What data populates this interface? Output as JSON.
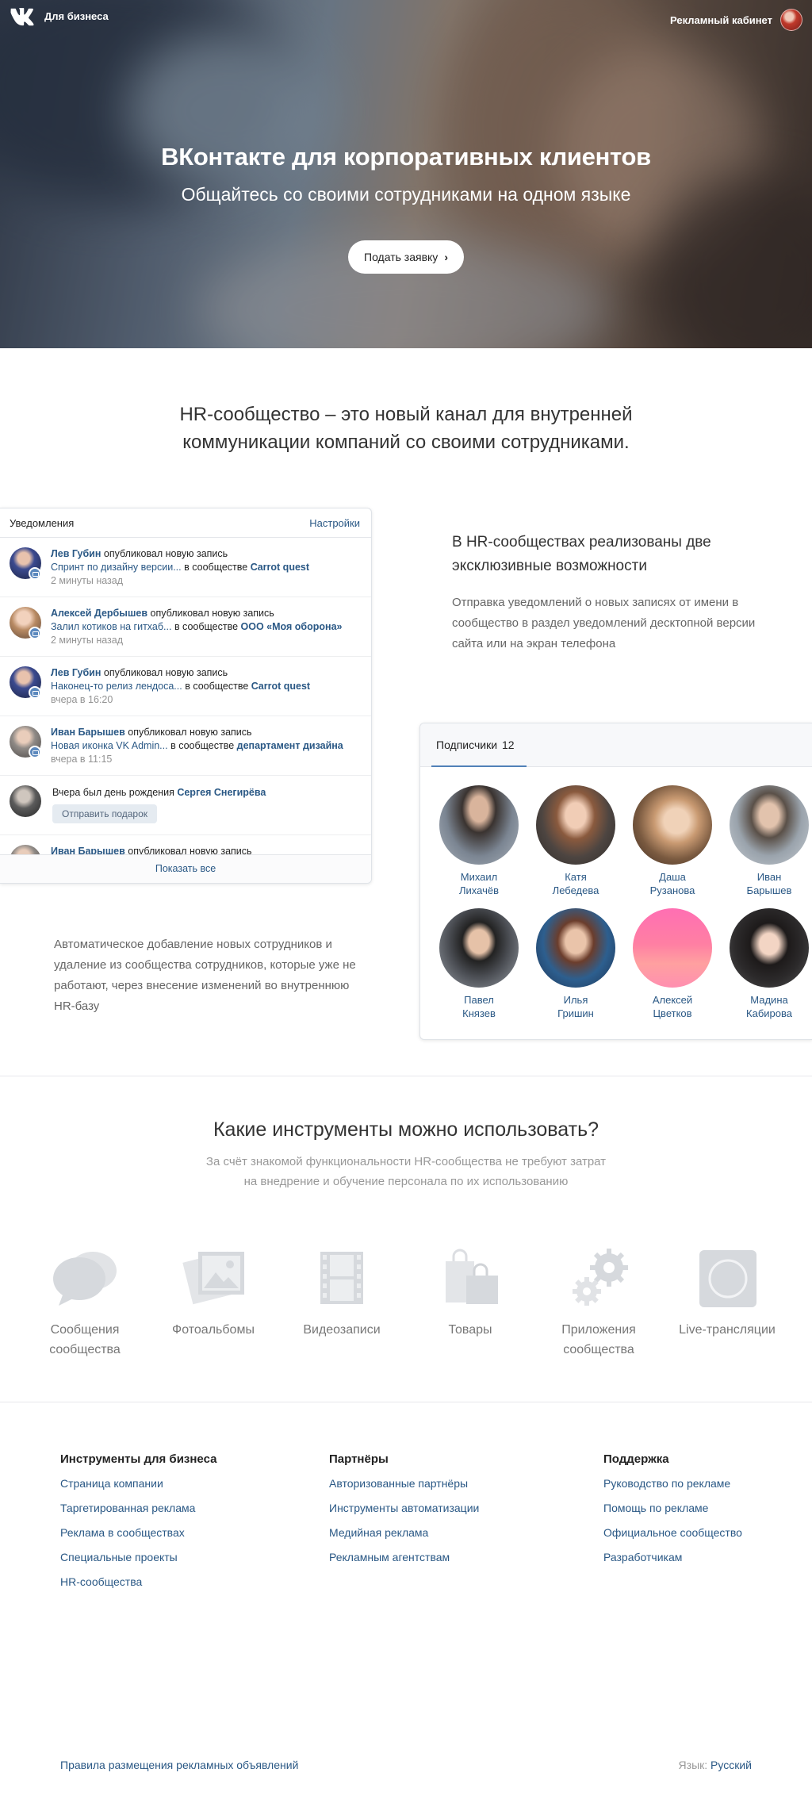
{
  "header": {
    "brand": "Для бизнеса",
    "cabinet": "Рекламный кабинет"
  },
  "hero": {
    "title": "ВКонтакте для корпоративных клиентов",
    "subtitle": "Общайтесь со своими сотрудниками на одном языке",
    "button": "Подать заявку"
  },
  "intro": "HR-сообщество – это новый канал для внутренней коммуникации компаний со своими сотрудниками.",
  "notifications": {
    "title": "Уведомления",
    "settings": "Настройки",
    "items": [
      {
        "author": "Лев Губин",
        "action": "опубликовал новую запись",
        "snippet": "Спринт по дизайну версии...",
        "in_group": "в сообществе",
        "group": "Carrot quest",
        "time": "2 минуты назад"
      },
      {
        "author": "Алексей Дербышев",
        "action": "опубликовал новую запись",
        "snippet": "Залил котиков на гитхаб...",
        "in_group": "в сообществе",
        "group": "ООО «Моя оборона»",
        "time": "2 минуты назад"
      },
      {
        "author": "Лев Губин",
        "action": "опубликовал новую запись",
        "snippet": "Наконец-то релиз лендоса...",
        "in_group": "в сообществе",
        "group": "Carrot quest",
        "time": "вчера в 16:20"
      },
      {
        "author": "Иван Барышев",
        "action": "опубликовал новую запись",
        "snippet": "Новая иконка VK Admin...",
        "in_group": "в сообществе",
        "group": "департамент дизайна",
        "time": "вчера в 11:15"
      }
    ],
    "birthday": {
      "text": "Вчера был день рождения",
      "person": "Сергея Снегирёва",
      "button": "Отправить подарок"
    },
    "last": {
      "author": "Иван Барышев",
      "action": "опубликовал новую запись"
    },
    "show_all": "Показать все"
  },
  "feature1": {
    "title": "В HR-сообществах реализованы две эксклюзивные возможности",
    "desc": "Отправка уведомлений о новых записях от имени в сообщество в раздел уведомлений десктопной версии сайта или на экран телефона"
  },
  "feature2": {
    "desc": "Автоматическое добавление новых сотрудников и удаление из сообщества сотрудников, которые уже не работают, через внесение изменений во внутреннюю HR-базу"
  },
  "subscribers": {
    "tab": "Подписчики",
    "count": "12",
    "people": [
      {
        "first": "Михаил",
        "last": "Лихачёв"
      },
      {
        "first": "Катя",
        "last": "Лебедева"
      },
      {
        "first": "Даша",
        "last": "Рузанова"
      },
      {
        "first": "Иван",
        "last": "Барышев"
      },
      {
        "first": "Павел",
        "last": "Князев"
      },
      {
        "first": "Илья",
        "last": "Гришин"
      },
      {
        "first": "Алексей",
        "last": "Цветков"
      },
      {
        "first": "Мадина",
        "last": "Кабирова"
      }
    ]
  },
  "tools": {
    "title": "Какие инструменты можно использовать?",
    "subtitle": "За счёт знакомой функциональности HR-сообщества не требуют затрат на внедрение и обучение персонала по их использованию",
    "items": [
      {
        "label1": "Сообщения",
        "label2": "сообщества",
        "icon": "messages-icon"
      },
      {
        "label1": "Фотоальбомы",
        "label2": "",
        "icon": "photo-albums-icon"
      },
      {
        "label1": "Видеозаписи",
        "label2": "",
        "icon": "video-icon"
      },
      {
        "label1": "Товары",
        "label2": "",
        "icon": "shopping-bags-icon"
      },
      {
        "label1": "Приложения",
        "label2": "сообщества",
        "icon": "gears-icon"
      },
      {
        "label1": "Live-трансляции",
        "label2": "",
        "icon": "live-icon"
      }
    ],
    "icon_color": "#d9dbdf"
  },
  "footer": {
    "col1": {
      "title": "Инструменты для бизнеса",
      "links": [
        "Страница компании",
        "Таргетированная реклама",
        "Реклама в сообществах",
        "Специальные проекты",
        "HR-сообщества"
      ]
    },
    "col2": {
      "title": "Партнёры",
      "links": [
        "Авторизованные партнёры",
        "Инструменты автоматизации",
        "Медийная реклама",
        "Рекламным агентствам"
      ]
    },
    "col3": {
      "title": "Поддержка",
      "links": [
        "Руководство по рекламе",
        "Помощь по рекламе",
        "Официальное сообщество",
        "Разработчикам"
      ]
    },
    "rules": "Правила размещения рекламных объявлений",
    "lang_label": "Язык:",
    "lang": "Русский"
  },
  "colors": {
    "link": "#2a5885",
    "accent": "#5181b8"
  }
}
